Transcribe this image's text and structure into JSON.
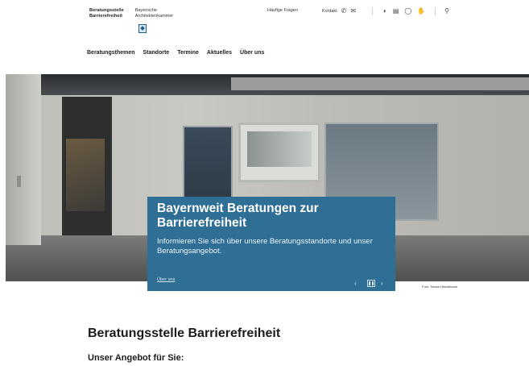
{
  "header": {
    "org_left_line1": "Beratungsstelle",
    "org_left_line2": "Barrierefreiheit",
    "org_right_line1": "Bayerische",
    "org_right_line2": "Architektenkammer",
    "faq_label": "Häufige Fragen",
    "contact_label": "Kontakt",
    "icons": [
      "phone-icon",
      "mail-icon",
      "contrast-icon",
      "print-icon",
      "easy-language-icon",
      "sign-language-icon",
      "search-icon"
    ]
  },
  "nav": {
    "items": [
      "Beratungsthemen",
      "Standorte",
      "Termine",
      "Aktuelles",
      "Über uns"
    ]
  },
  "hero": {
    "title": "Bayernweit Beratungen zur Barrierefreiheit",
    "text": "Informieren Sie sich über unsere Beratungsstandorte und unser Beratungsangebot.",
    "link": "Über uns",
    "photo_credit": "Foto: Tobias Hirschbaum"
  },
  "main": {
    "title": "Beratungsstelle Barrierefreiheit",
    "subtitle": "Unser Angebot für Sie:"
  }
}
